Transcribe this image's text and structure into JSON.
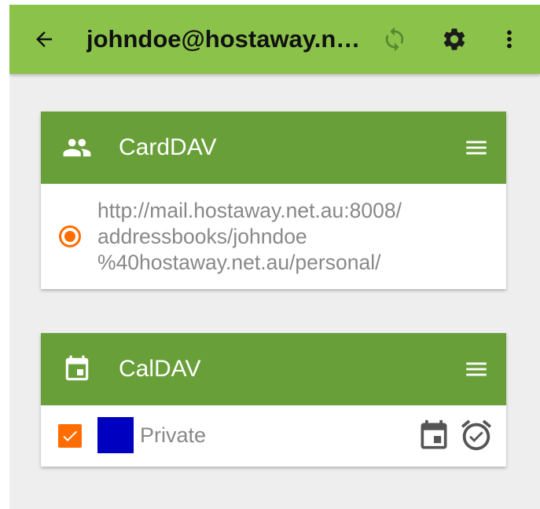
{
  "appbar": {
    "title": "johndoe@hostaway.n…",
    "icons": {
      "back": "arrow-back-icon",
      "sync": "sync-icon",
      "settings": "gear-icon",
      "more": "more-vert-icon"
    },
    "color": "#8bc34a"
  },
  "carddav": {
    "title": "CardDAV",
    "header_icon": "people-icon",
    "url_lines": [
      "http://mail.hostaway.net.au:8008/",
      "addressbooks/johndoe",
      "%40hostaway.net.au/personal/"
    ],
    "selected": true
  },
  "caldav": {
    "title": "CalDAV",
    "header_icon": "calendar-icon",
    "calendars": [
      {
        "name": "Private",
        "checked": true,
        "color": "#0000c0",
        "icons": [
          "calendar-event-icon",
          "alarm-check-icon"
        ]
      }
    ]
  },
  "colors": {
    "card_header": "#689f38",
    "accent": "#ff6d00",
    "background": "#eeeeee"
  }
}
